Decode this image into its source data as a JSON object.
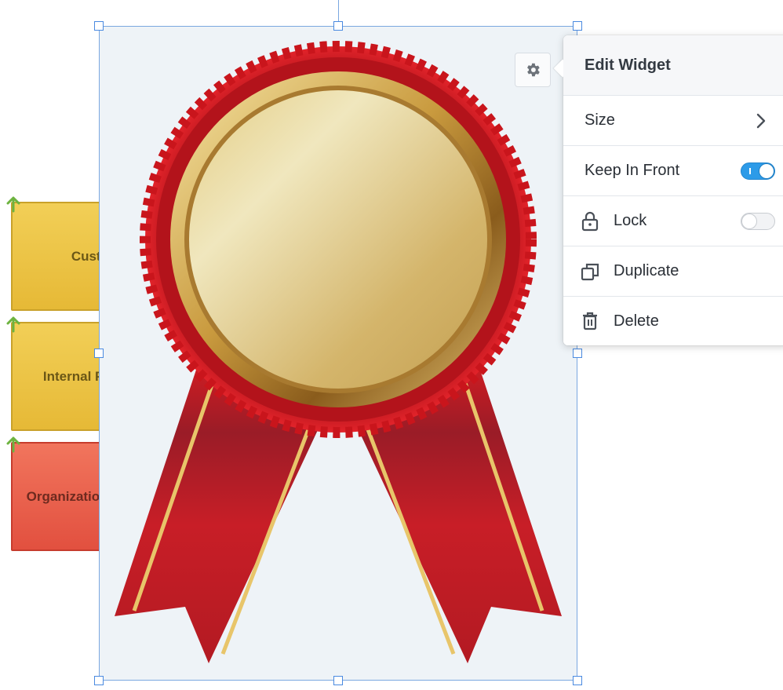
{
  "strategy_map": {
    "boxes": [
      {
        "label": "Customer"
      },
      {
        "label": "Internal Processes"
      },
      {
        "label": "Organizational Capacity"
      }
    ]
  },
  "widget": {
    "image": "award-ribbon-medal",
    "background_color": "#eef3f7",
    "selection_color": "#7aa7e0"
  },
  "menu": {
    "title": "Edit Widget",
    "items": {
      "size": {
        "label": "Size"
      },
      "keep_in_front": {
        "label": "Keep In Front",
        "toggle": true
      },
      "lock": {
        "label": "Lock",
        "toggle": false
      },
      "duplicate": {
        "label": "Duplicate"
      },
      "delete": {
        "label": "Delete"
      }
    }
  },
  "colors": {
    "accent": "#2d9be8",
    "arrow_green": "#6db33f",
    "yellow_box": "#f2cf57",
    "red_box": "#e2503f"
  },
  "icons": [
    "up-arrow-icon",
    "gear-icon",
    "chevron-right-icon",
    "lock-icon",
    "duplicate-icon",
    "trash-icon"
  ]
}
